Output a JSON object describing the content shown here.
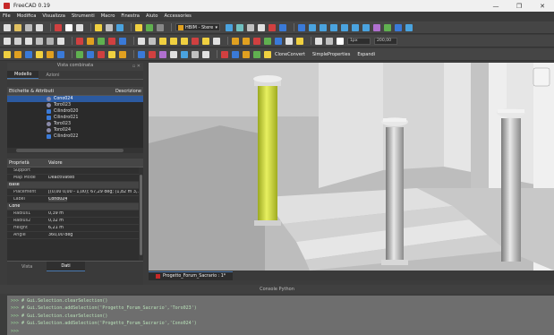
{
  "window": {
    "title": "FreeCAD 0.19",
    "controls": [
      "—",
      "❐",
      "✕"
    ]
  },
  "menu": [
    "File",
    "Modifica",
    "Visualizza",
    "Strumenti",
    "Macro",
    "Finestra",
    "Aiuto",
    "Accessories"
  ],
  "toolbar": {
    "workbench": "HBIM - Stere",
    "text_buttons": [
      "CloneConvert",
      "SimpleProperties",
      "Espandi"
    ],
    "field1": "1px",
    "field2": "200,00",
    "colors": [
      "#4aa3df",
      "#e0a020",
      "#d04040",
      "#60b050",
      "#b070d0",
      "#e0e0e0",
      "#f0d040",
      "#3a7ad8",
      "#c0c0c0",
      "#70c0c0"
    ]
  },
  "combo": {
    "title": "Vista combinata",
    "tabs": [
      "Modello",
      "Azioni"
    ],
    "tree_header": {
      "labels": "Etichette & Attributi",
      "description": "Descrizione"
    },
    "tree_items": [
      {
        "label": "Cono024",
        "kind": "cone",
        "selected": true
      },
      {
        "label": "Toro023",
        "kind": "torus",
        "selected": false
      },
      {
        "label": "Cilindro020",
        "kind": "cylinder",
        "selected": false
      },
      {
        "label": "Cilindro021",
        "kind": "cylinder",
        "selected": false
      },
      {
        "label": "Toro023",
        "kind": "torus",
        "selected": false
      },
      {
        "label": "Toro024",
        "kind": "torus",
        "selected": false
      },
      {
        "label": "Cilindro022",
        "kind": "cylinder",
        "selected": false
      }
    ],
    "prop_header": {
      "property": "Proprietà",
      "value": "Valore"
    },
    "properties": [
      {
        "key": "Support",
        "value": "",
        "type": "row"
      },
      {
        "key": "Map Mode",
        "value": "Deactivated",
        "type": "row"
      },
      {
        "key": "Base",
        "value": "",
        "type": "group"
      },
      {
        "key": "Placement",
        "value": "[(0,00 0,00 - 1,00); 67,29 deg; (1,82 m 3,...",
        "type": "row"
      },
      {
        "key": "Label",
        "value": "Cono024",
        "type": "row"
      },
      {
        "key": "Cone",
        "value": "",
        "type": "group"
      },
      {
        "key": "Radius1",
        "value": "0,39 m",
        "type": "row"
      },
      {
        "key": "Radius2",
        "value": "0,32 m",
        "type": "row"
      },
      {
        "key": "Height",
        "value": "6,21 m",
        "type": "row"
      },
      {
        "key": "Angle",
        "value": "360,00 deg",
        "type": "row"
      }
    ],
    "bottom_tabs": [
      "Vista",
      "Dati"
    ]
  },
  "document_tab": "Progetto_Forum_Sacrario : 1*",
  "console": {
    "title": "Console Python",
    "lines": [
      {
        "prompt": ">>>",
        "code": "# Gui.Selection.clearSelection()"
      },
      {
        "prompt": ">>>",
        "code": "# Gui.Selection.addSelection('Progetto_Forum_Sacrario','Toro023')"
      },
      {
        "prompt": ">>>",
        "code": "# Gui.Selection.clearSelection()"
      },
      {
        "prompt": ">>>",
        "code": "# Gui.Selection.addSelection('Progetto_Forum_Sacrario','Cono024')"
      },
      {
        "prompt": ">>>",
        "code": ""
      }
    ]
  },
  "colors": {
    "selection": "#2c5aa0",
    "highlight_column": "#c8d22a",
    "viewport_bg": "#bdbdbd"
  }
}
